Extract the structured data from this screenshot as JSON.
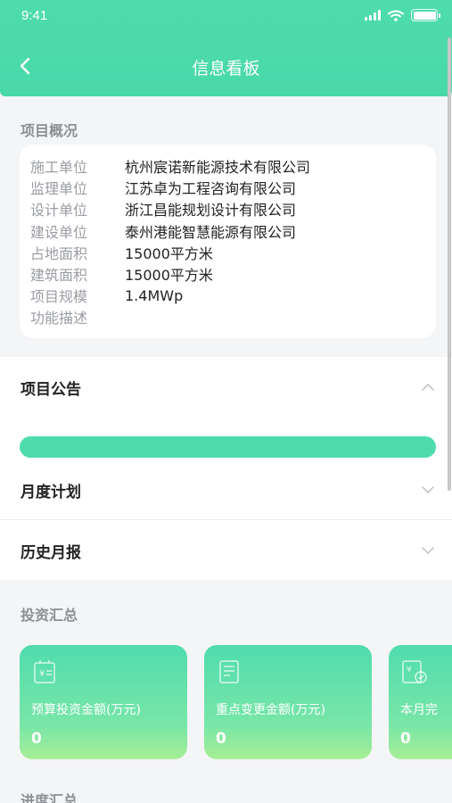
{
  "status_bar": {
    "time": "9:41"
  },
  "header": {
    "title": "信息看板"
  },
  "overview": {
    "heading": "项目概况",
    "rows": [
      {
        "label": "施工单位",
        "value": "杭州宸诺新能源技术有限公司"
      },
      {
        "label": "监理单位",
        "value": "江苏卓为工程咨询有限公司"
      },
      {
        "label": "设计单位",
        "value": "浙江昌能规划设计有限公司"
      },
      {
        "label": "建设单位",
        "value": "泰州港能智慧能源有限公司"
      },
      {
        "label": "占地面积",
        "value": "15000平方米"
      },
      {
        "label": "建筑面积",
        "value": "15000平方米"
      },
      {
        "label": "项目规模",
        "value": "1.4MWp"
      },
      {
        "label": "功能描述",
        "value": ""
      }
    ]
  },
  "announcement": {
    "title": "项目公告",
    "expanded": true
  },
  "monthly_plan": {
    "title": "月度计划"
  },
  "history_report": {
    "title": "历史月报"
  },
  "investment": {
    "heading": "投资汇总",
    "cards": [
      {
        "label": "预算投资金额(万元)",
        "value": "0",
        "icon": "budget-icon"
      },
      {
        "label": "重点变更金额(万元)",
        "value": "0",
        "icon": "change-amount-icon"
      },
      {
        "label": "本月完",
        "value": "0",
        "icon": "monthly-complete-icon"
      }
    ]
  },
  "progress": {
    "heading": "进度汇总"
  },
  "colors": {
    "accent": "#4fdcad",
    "background": "#f4f5f7"
  }
}
